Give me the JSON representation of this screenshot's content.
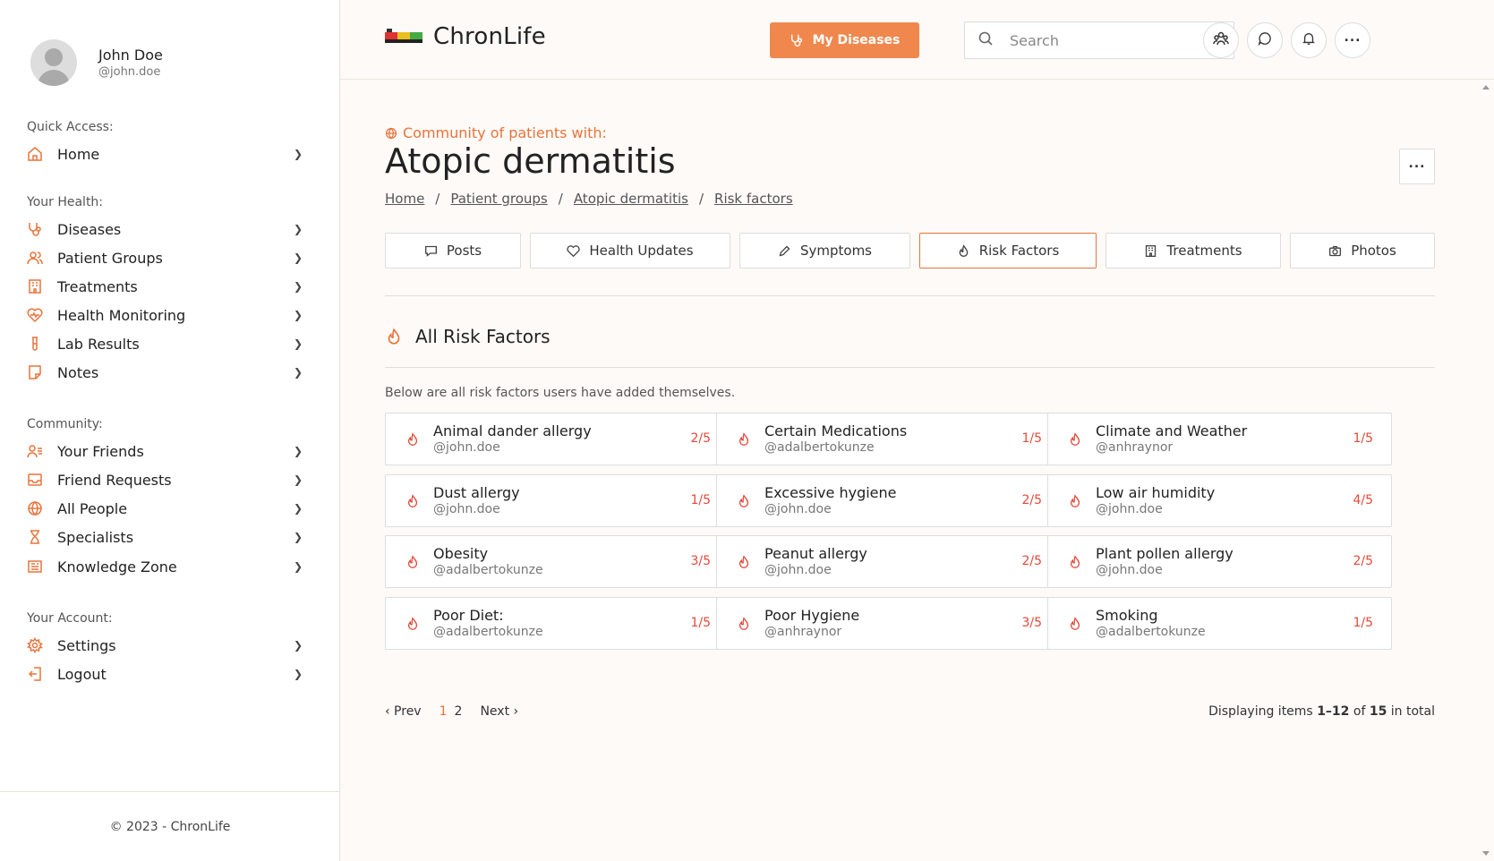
{
  "profile": {
    "name": "John Doe",
    "handle": "@john.doe"
  },
  "sidebar": {
    "quick_access": {
      "title": "Quick Access:",
      "items": [
        {
          "label": "Home",
          "icon": "home-icon"
        }
      ]
    },
    "your_health": {
      "title": "Your Health:",
      "items": [
        {
          "label": "Diseases",
          "icon": "stethoscope-icon"
        },
        {
          "label": "Patient Groups",
          "icon": "users-icon"
        },
        {
          "label": "Treatments",
          "icon": "building-icon"
        },
        {
          "label": "Health Monitoring",
          "icon": "heart-pulse-icon"
        },
        {
          "label": "Lab Results",
          "icon": "test-tube-icon"
        },
        {
          "label": "Notes",
          "icon": "note-icon"
        }
      ]
    },
    "community": {
      "title": "Community:",
      "items": [
        {
          "label": "Your Friends",
          "icon": "user-list-icon"
        },
        {
          "label": "Friend Requests",
          "icon": "inbox-icon"
        },
        {
          "label": "All People",
          "icon": "globe-icon"
        },
        {
          "label": "Specialists",
          "icon": "hourglass-icon"
        },
        {
          "label": "Knowledge Zone",
          "icon": "book-icon"
        }
      ]
    },
    "your_account": {
      "title": "Your Account:",
      "items": [
        {
          "label": "Settings",
          "icon": "gear-icon"
        },
        {
          "label": "Logout",
          "icon": "logout-icon"
        }
      ]
    },
    "footer": "© 2023 - ChronLife"
  },
  "header": {
    "brand": "ChronLife",
    "my_diseases_label": "My Diseases",
    "search_placeholder": "Search"
  },
  "page": {
    "community_label": "Community of patients with:",
    "title": "Atopic dermatitis",
    "breadcrumb": [
      "Home",
      "Patient groups",
      "Atopic dermatitis",
      "Risk factors"
    ],
    "tabs": [
      {
        "label": "Posts",
        "icon": "comment-icon",
        "active": false
      },
      {
        "label": "Health Updates",
        "icon": "heart-icon",
        "active": false
      },
      {
        "label": "Symptoms",
        "icon": "pencil-icon",
        "active": false
      },
      {
        "label": "Risk Factors",
        "icon": "flame-icon",
        "active": true
      },
      {
        "label": "Treatments",
        "icon": "building-icon",
        "active": false
      },
      {
        "label": "Photos",
        "icon": "camera-icon",
        "active": false
      }
    ],
    "section_title": "All Risk Factors",
    "intro": "Below are all risk factors users have added themselves.",
    "risk_factors": [
      {
        "title": "Animal dander allergy",
        "user": "@john.doe",
        "score": "2/5"
      },
      {
        "title": "Certain Medications",
        "user": "@adalbertokunze",
        "score": "1/5"
      },
      {
        "title": "Climate and Weather",
        "user": "@anhraynor",
        "score": "1/5"
      },
      {
        "title": "Dust allergy",
        "user": "@john.doe",
        "score": "1/5"
      },
      {
        "title": "Excessive hygiene",
        "user": "@john.doe",
        "score": "2/5"
      },
      {
        "title": "Low air humidity",
        "user": "@john.doe",
        "score": "4/5"
      },
      {
        "title": "Obesity",
        "user": "@adalbertokunze",
        "score": "3/5"
      },
      {
        "title": "Peanut allergy",
        "user": "@john.doe",
        "score": "2/5"
      },
      {
        "title": "Plant pollen allergy",
        "user": "@john.doe",
        "score": "2/5"
      },
      {
        "title": "Poor Diet:",
        "user": "@adalbertokunze",
        "score": "1/5"
      },
      {
        "title": "Poor Hygiene",
        "user": "@anhraynor",
        "score": "3/5"
      },
      {
        "title": "Smoking",
        "user": "@adalbertokunze",
        "score": "1/5"
      }
    ],
    "pagination": {
      "prev": "‹ Prev",
      "pages": [
        "1",
        "2"
      ],
      "current": "1",
      "next": "Next ›"
    },
    "display": {
      "prefix": "Displaying items",
      "range": "1–12",
      "of": "of",
      "total": "15",
      "suffix": "in total"
    }
  },
  "colors": {
    "accent": "#e8743b",
    "button": "#f0884e",
    "risk": "#e24a3a",
    "background": "#fdfaf7"
  }
}
